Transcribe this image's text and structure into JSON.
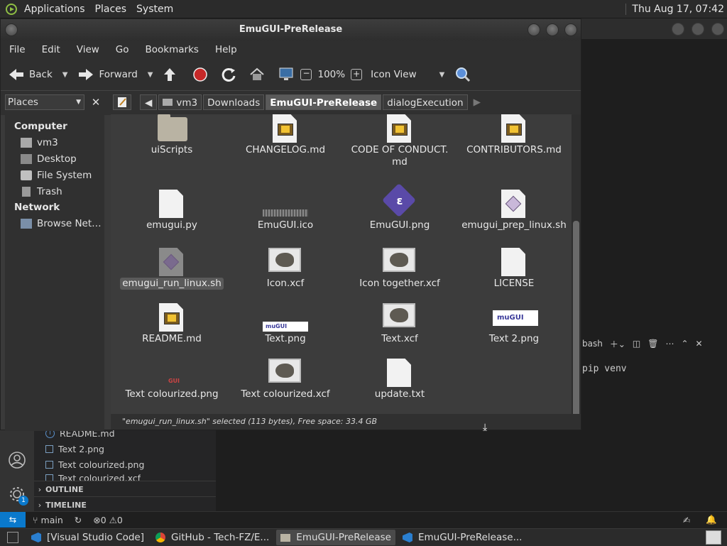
{
  "top_panel": {
    "menus": [
      "Applications",
      "Places",
      "System"
    ],
    "clock": "Thu Aug 17, 07:42"
  },
  "window": {
    "title": "EmuGUI-PreRelease",
    "menu": [
      "File",
      "Edit",
      "View",
      "Go",
      "Bookmarks",
      "Help"
    ],
    "toolbar": {
      "back": "Back",
      "forward": "Forward",
      "zoom": "100%",
      "view_mode": "Icon View"
    },
    "places_combo": "Places",
    "breadcrumbs": [
      "vm3",
      "Downloads",
      "EmuGUI-PreRelease",
      "dialogExecution"
    ],
    "sidebar": {
      "computer_header": "Computer",
      "computer_items": [
        "vm3",
        "Desktop",
        "File System",
        "Trash"
      ],
      "network_header": "Network",
      "network_items": [
        "Browse Net…"
      ]
    },
    "files": [
      {
        "name": "uiScripts",
        "icon": "folder"
      },
      {
        "name": "CHANGELOG.md",
        "icon": "doc-image"
      },
      {
        "name": "CODE OF CONDUCT.\nmd",
        "icon": "doc-image"
      },
      {
        "name": "CONTRIBUTORS.md",
        "icon": "doc-image"
      },
      {
        "name": "emugui.py",
        "icon": "doc-blank"
      },
      {
        "name": "EmuGUI.ico",
        "icon": "ico"
      },
      {
        "name": "EmuGUI.png",
        "icon": "emu-logo",
        "logo_letter": "ɛ"
      },
      {
        "name": "emugui_prep_linux.sh",
        "icon": "doc-script"
      },
      {
        "name": "emugui_run_linux.sh",
        "icon": "doc-script-selected"
      },
      {
        "name": "Icon.xcf",
        "icon": "xcf"
      },
      {
        "name": "Icon together.xcf",
        "icon": "xcf"
      },
      {
        "name": "LICENSE",
        "icon": "doc-blank"
      },
      {
        "name": "README.md",
        "icon": "doc-image"
      },
      {
        "name": "Text.png",
        "icon": "png-strip",
        "strip_text": "muGUI"
      },
      {
        "name": "Text.xcf",
        "icon": "xcf"
      },
      {
        "name": "Text 2.png",
        "icon": "png-strip2",
        "strip_text": "muGUI"
      },
      {
        "name": "Text colourized.png",
        "icon": "colour-strip",
        "strip_text": "GUI"
      },
      {
        "name": "Text colourized.xcf",
        "icon": "xcf"
      },
      {
        "name": "update.txt",
        "icon": "doc-blank"
      }
    ],
    "status": "\"emugui_run_linux.sh\" selected (113 bytes), Free space: 33.4 GB"
  },
  "vscode": {
    "explorer_items": [
      "README.md",
      "Text 2.png",
      "Text colourized.png",
      "Text colourized.xcf"
    ],
    "sections": [
      "OUTLINE",
      "TIMELINE"
    ],
    "terminal_label": "bash",
    "terminal_text": "pip venv",
    "status_branch": "main",
    "status_problems": "⊗0 ⚠0",
    "badge": "1"
  },
  "taskbar": [
    {
      "label": "[Visual Studio Code]",
      "icon": "vscode-icon",
      "active": false
    },
    {
      "label": "GitHub - Tech-FZ/E...",
      "icon": "chrome-icon",
      "active": false
    },
    {
      "label": "EmuGUI-PreRelease",
      "icon": "folder-icon",
      "active": true
    },
    {
      "label": "EmuGUI-PreRelease...",
      "icon": "vscode-icon",
      "active": false
    }
  ]
}
